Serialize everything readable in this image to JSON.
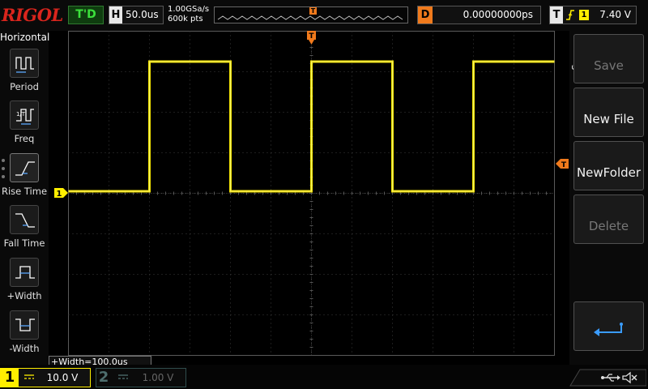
{
  "brand": {
    "logo_text": "RIGOL"
  },
  "header": {
    "run_status": "T'D",
    "horizontal_label": "H",
    "timebase": "50.0us",
    "sample_rate": "1.00GSa/s",
    "memory_depth": "600k pts",
    "trigger_pos_mark": "T",
    "delay_label": "D",
    "delay_value": "0.00000000ps",
    "trigger_label": "T",
    "trigger_channel": "1",
    "trigger_level": "7.40 V"
  },
  "left_menu": {
    "title": "Horizontal",
    "items": [
      {
        "label": "Period",
        "icon": "period-icon"
      },
      {
        "label": "Freq",
        "icon": "freq-icon"
      },
      {
        "label": "Rise Time",
        "icon": "rise-time-icon"
      },
      {
        "label": "Fall Time",
        "icon": "fall-time-icon"
      },
      {
        "label": "+Width",
        "icon": "positive-width-icon"
      },
      {
        "label": "-Width",
        "icon": "negative-width-icon"
      }
    ]
  },
  "display": {
    "ch1_marker": "1",
    "trigger_marker": "T",
    "trigger_level_marker": "T",
    "measurement_readout": "+Width=100.0us"
  },
  "right_menu": {
    "title": "Save",
    "buttons": [
      {
        "label": "Save",
        "enabled": false
      },
      {
        "label": "New File",
        "enabled": true
      },
      {
        "label": "NewFolder",
        "enabled": true
      },
      {
        "label": "Delete",
        "enabled": false
      }
    ],
    "enter_icon": "enter-icon"
  },
  "channels": [
    {
      "number": "1",
      "scale": "10.0 V",
      "active": true,
      "color": "#ffee00"
    },
    {
      "number": "2",
      "scale": "1.00 V",
      "active": false,
      "color": "#4e6e6e"
    }
  ],
  "status_icons": [
    "usb-icon",
    "speaker-muted-icon"
  ],
  "colors": {
    "ch1": "#ffee00",
    "trigger": "#f07a1c",
    "brand": "#d9251d",
    "run_status": "#3ce03c"
  },
  "waveform": {
    "channel": "1",
    "type": "square",
    "high_level_div": 3.2,
    "low_level_div": 0,
    "pulse_width_div": 2,
    "period_div": 4,
    "first_rising_edge_div": 2
  }
}
